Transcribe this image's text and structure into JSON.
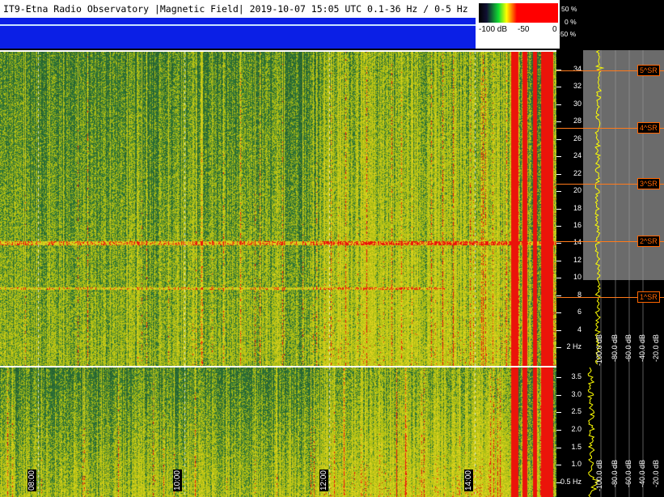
{
  "header": {
    "title": "IT9-Etna Radio Observatory |Magnetic Field| 2019-10-07 15:05 UTC 0.1-36 Hz / 0-5 Hz"
  },
  "legend": {
    "left_label": "-100 dB",
    "mid_label": "-50",
    "right_label": "0",
    "pct_top": "50 %",
    "pct_mid": "0 %",
    "pct_bot": "-50 %"
  },
  "upper_axis": {
    "ticks": [
      "34",
      "32",
      "30",
      "28",
      "26",
      "24",
      "22",
      "20",
      "18",
      "16",
      "14",
      "12",
      "10",
      "8",
      "6",
      "4",
      "2 Hz"
    ]
  },
  "lower_axis": {
    "ticks": [
      "3.5",
      "3.0",
      "2.5",
      "2.0",
      "1.5",
      "1.0",
      "0.5 Hz"
    ]
  },
  "schumann": {
    "labels": [
      "5^SR",
      "4^SR",
      "3^SR",
      "2^SR",
      "1^SR"
    ]
  },
  "time_labels": [
    "08:00",
    "10:00",
    "12:00",
    "14:00"
  ],
  "db_labels": {
    "upper": [
      "-100.0 dB",
      "-80.0 dB",
      "-60.0 dB",
      "-40.0 dB",
      "-20.0 dB"
    ],
    "lower": [
      "-100.0 dB",
      "-80.0 dB",
      "-60.0 dB",
      "-40.0 dB",
      "-20.0 dB"
    ]
  },
  "colors": {
    "accent_orange": "#ff7a1a",
    "strip_blue": "#0b1fe6",
    "trace_yellow": "#ffff00"
  }
}
